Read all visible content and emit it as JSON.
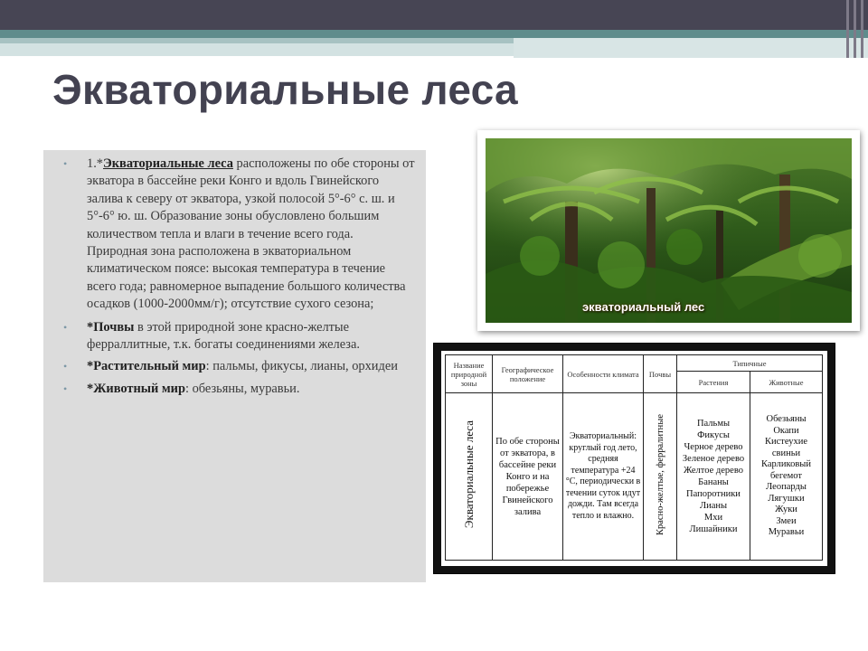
{
  "slide": {
    "title": "Экваториальные леса"
  },
  "text_block": {
    "p1_prefix": "1.*",
    "p1_bold": "Экваториальные леса",
    "p1_text": " расположены по обе стороны от экватора в  бассейне реки Конго и вдоль Гвинейского залива к северу от экватора, узкой полосой 5°-6°  с. ш. и 5°-6°  ю. ш.  Образование зоны обусловлено большим количеством тепла и влаги в течение всего года. Природная  зона расположена в экваториальном климатическом поясе: высокая температура в течение всего года;  равномерное выпадение большого количества осадков (1000-2000мм/г); отсутствие сухого сезона;",
    "p2_bold": "*Почвы",
    "p2_text": " в этой природной зоне красно-желтые ферраллитные, т.к. богаты соединениями железа.",
    "p3_bold": "*Растительный мир",
    "p3_text": ": пальмы, фикусы, лианы, орхидеи",
    "p4_bold": "*Животный мир",
    "p4_text": ": обезьяны, муравьи."
  },
  "photo": {
    "caption": "экваториальный лес"
  },
  "table": {
    "headers": {
      "name": "Название природной зоны",
      "geo": "Географическое положение",
      "climate": "Особенности климата",
      "soils": "Почвы",
      "typical": "Типичные",
      "plants": "Растения",
      "animals": "Животные"
    },
    "row": {
      "zone": "Экваториальные леса",
      "geo": "По обе стороны от экватора, в бассейне реки Конго и на побережье Гвинейского залива",
      "climate": "Экваториальный: круглый год лето, средняя температура +24 °С, периодически в течении суток идут дожди. Там всегда тепло и влажно.",
      "soils": "Красно-желтые, ферралитные",
      "plants": [
        "Пальмы",
        "Фикусы",
        "Черное дерево",
        "Зеленое дерево",
        "Желтое дерево",
        "Бананы",
        "Папоротники",
        "Лианы",
        "Мхи",
        "Лишайники"
      ],
      "animals": [
        "Обезьяны",
        "Окапи",
        "Кистеухие",
        "свиньи",
        "Карликовый",
        "бегемот",
        "Леопарды",
        "Лягушки",
        "Жуки",
        "Змеи",
        "Муравьи"
      ]
    }
  }
}
